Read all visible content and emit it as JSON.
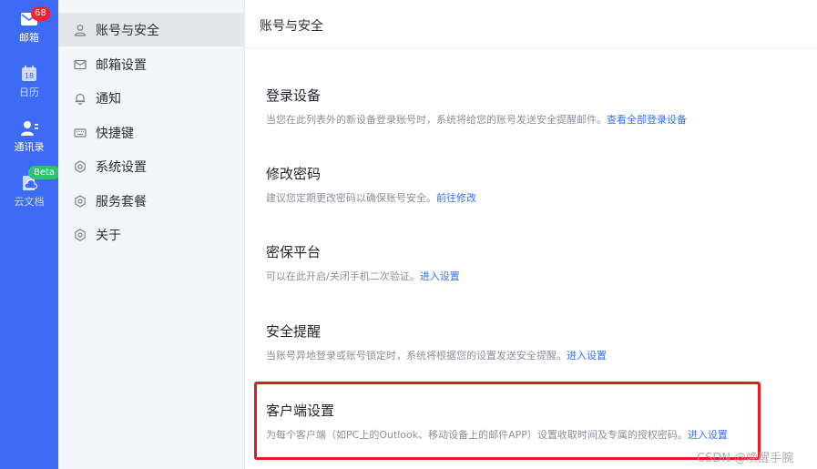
{
  "rail": {
    "mail": {
      "label": "邮箱",
      "badge": "68"
    },
    "calendar": {
      "label": "日历",
      "day": "18"
    },
    "contacts": {
      "label": "通讯录"
    },
    "docs": {
      "label": "云文档",
      "badge": "Beta"
    }
  },
  "sidebar": {
    "items": [
      {
        "label": "账号与安全",
        "icon": "user-icon"
      },
      {
        "label": "邮箱设置",
        "icon": "mail-icon"
      },
      {
        "label": "通知",
        "icon": "bell-icon"
      },
      {
        "label": "快捷键",
        "icon": "keyboard-icon"
      },
      {
        "label": "系统设置",
        "icon": "hexagon-gear-icon"
      },
      {
        "label": "服务套餐",
        "icon": "hexagon-gear-icon"
      },
      {
        "label": "关于",
        "icon": "hexagon-gear-icon"
      }
    ]
  },
  "main": {
    "title": "账号与安全",
    "sections": [
      {
        "title": "登录设备",
        "desc": "当您在此列表外的新设备登录账号时，系统将给您的账号发送安全提醒邮件。",
        "link": "查看全部登录设备"
      },
      {
        "title": "修改密码",
        "desc": "建议您定期更改密码以确保账号安全。",
        "link": "前往修改"
      },
      {
        "title": "密保平台",
        "desc": "可以在此开启/关闭手机二次验证。",
        "link": "进入设置"
      },
      {
        "title": "安全提醒",
        "desc": "当账号异地登录或账号锁定时，系统将根据您的设置发送安全提醒。",
        "link": "进入设置"
      },
      {
        "title": "客户端设置",
        "desc": "为每个客户端（如PC上的Outlook、移动设备上的邮件APP）设置收取时间及专属的授权密码。",
        "link": "进入设置"
      }
    ]
  },
  "watermark": "CSDN @唤醒手腕",
  "colors": {
    "rail": "#3d6bf5",
    "link": "#3370ff",
    "highlight": "#e8191c",
    "badge": "#f5222d",
    "beta": "#28c76f"
  }
}
